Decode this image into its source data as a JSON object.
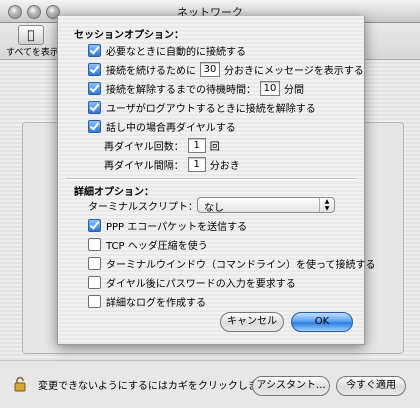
{
  "window": {
    "title": "ネットワーク"
  },
  "toolbar": {
    "show_all_label": "すべてを表示",
    "show_all_icon": "apple-icon"
  },
  "sheet": {
    "section1_title": "セッションオプション：",
    "options": [
      {
        "checked": true,
        "label": "必要なときに自動的に接続する"
      },
      {
        "checked": true,
        "label_before": "接続を続けるために",
        "value": "30",
        "label_after": "分おきにメッセージを表示する"
      },
      {
        "checked": true,
        "label_before": "接続を解除するまでの待機時間：",
        "value": "10",
        "label_after": "分間"
      },
      {
        "checked": true,
        "label": "ユーザがログアウトするときに接続を解除する"
      },
      {
        "checked": true,
        "label": "話し中の場合再ダイヤルする"
      }
    ],
    "redial_count": {
      "label": "再ダイヤル回数：",
      "value": "1",
      "unit": "回"
    },
    "redial_interval": {
      "label": "再ダイヤル間隔：",
      "value": "1",
      "unit": "分おき"
    },
    "section2_title": "詳細オプション：",
    "terminal_script": {
      "label": "ターミナルスクリプト：",
      "value": "なし"
    },
    "advanced": [
      {
        "checked": true,
        "label": "PPP エコーパケットを送信する"
      },
      {
        "checked": false,
        "label": "TCP ヘッダ圧縮を使う"
      },
      {
        "checked": false,
        "label": "ターミナルウインドウ（コマンドライン）を使って接続する"
      },
      {
        "checked": false,
        "label": "ダイヤル後にパスワードの入力を要求する"
      },
      {
        "checked": false,
        "label": "詳細なログを作成する"
      }
    ],
    "cancel_label": "キャンセル",
    "ok_label": "OK"
  },
  "bottom": {
    "lock_text": "変更できないようにするにはカギをクリックします。",
    "assistant_label": "アシスタント...",
    "apply_label": "今すぐ適用"
  },
  "colors": {
    "accent": "#2b7ce0",
    "checkbox_on": "#3b82dc"
  }
}
